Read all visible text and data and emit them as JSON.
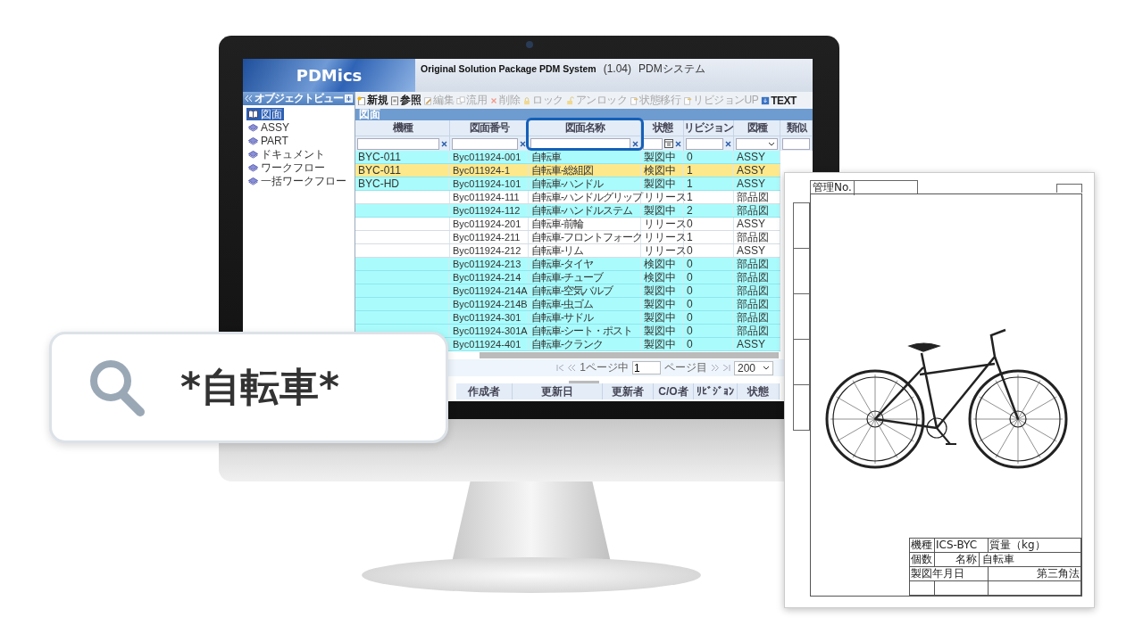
{
  "app": {
    "logo": "PDMics",
    "title": "Original Solution Package PDM System",
    "version": "(1.04)",
    "subtitle": "PDMシステム"
  },
  "sidebar": {
    "title": "オブジェクトビュー",
    "items": [
      {
        "label": "図面",
        "selected": true
      },
      {
        "label": "ASSY",
        "selected": false
      },
      {
        "label": "PART",
        "selected": false
      },
      {
        "label": "ドキュメント",
        "selected": false
      },
      {
        "label": "ワークフロー",
        "selected": false
      },
      {
        "label": "一括ワークフロー",
        "selected": false
      }
    ]
  },
  "toolbar": {
    "buttons": [
      {
        "label": "新規",
        "disabled": false
      },
      {
        "label": "参照",
        "disabled": false
      },
      {
        "label": "編集",
        "disabled": true
      },
      {
        "label": "流用",
        "disabled": true
      },
      {
        "label": "削除",
        "disabled": true
      },
      {
        "label": "ロック",
        "disabled": true
      },
      {
        "label": "アンロック",
        "disabled": true
      },
      {
        "label": "状態移行",
        "disabled": true
      },
      {
        "label": "リビジョンUP",
        "disabled": true
      },
      {
        "label": "TEXT",
        "disabled": false
      }
    ]
  },
  "panel_title": "図面",
  "table": {
    "columns": [
      "機種",
      "図面番号",
      "図面名称",
      "状態",
      "リビジョン",
      "図種",
      "類似"
    ],
    "rows": [
      {
        "model": "BYC-011",
        "number": "Byc011924-001",
        "name": "自転車",
        "status": "製図中",
        "revision": "0",
        "type": "ASSY",
        "selected": false,
        "highlighted": true
      },
      {
        "model": "BYC-011",
        "number": "Byc011924-1",
        "name": "自転車-総組図",
        "status": "検図中",
        "revision": "1",
        "type": "ASSY",
        "selected": true,
        "highlighted": true
      },
      {
        "model": "BYC-HD",
        "number": "Byc011924-101",
        "name": "自転車-ハンドル",
        "status": "製図中",
        "revision": "1",
        "type": "ASSY",
        "selected": false,
        "highlighted": true
      },
      {
        "number": "Byc011924-111",
        "name": "自転車-ハンドルグリップ",
        "status": "リリース",
        "revision": "1",
        "type": "部品図",
        "selected": false,
        "highlighted": false
      },
      {
        "number": "Byc011924-112",
        "name": "自転車-ハンドルステム",
        "status": "製図中",
        "revision": "2",
        "type": "部品図",
        "selected": false,
        "highlighted": true
      },
      {
        "number": "Byc011924-201",
        "name": "自転車-前輪",
        "status": "リリース",
        "revision": "0",
        "type": "ASSY",
        "selected": false,
        "highlighted": false
      },
      {
        "number": "Byc011924-211",
        "name": "自転車-フロントフォーク",
        "status": "リリース",
        "revision": "1",
        "type": "部品図",
        "selected": false,
        "highlighted": false
      },
      {
        "number": "Byc011924-212",
        "name": "自転車-リム",
        "status": "リリース",
        "revision": "0",
        "type": "ASSY",
        "selected": false,
        "highlighted": false
      },
      {
        "number": "Byc011924-213",
        "name": "自転車-タイヤ",
        "status": "検図中",
        "revision": "0",
        "type": "部品図",
        "selected": false,
        "highlighted": true
      },
      {
        "number": "Byc011924-214",
        "name": "自転車-チューブ",
        "status": "検図中",
        "revision": "0",
        "type": "部品図",
        "selected": false,
        "highlighted": true
      },
      {
        "number": "Byc011924-214A",
        "name": "自転車-空気バルブ",
        "status": "製図中",
        "revision": "0",
        "type": "部品図",
        "selected": false,
        "highlighted": true
      },
      {
        "number": "Byc011924-214B",
        "name": "自転車-虫ゴム",
        "status": "製図中",
        "revision": "0",
        "type": "部品図",
        "selected": false,
        "highlighted": true
      },
      {
        "number": "Byc011924-301",
        "name": "自転車-サドル",
        "status": "製図中",
        "revision": "0",
        "type": "部品図",
        "selected": false,
        "highlighted": true
      },
      {
        "number": "Byc011924-301A",
        "name": "自転車-シート・ポスト",
        "status": "製図中",
        "revision": "0",
        "type": "部品図",
        "selected": false,
        "highlighted": true
      },
      {
        "number": "Byc011924-401",
        "name": "自転車-クランク",
        "status": "製図中",
        "revision": "0",
        "type": "ASSY",
        "selected": false,
        "highlighted": true
      }
    ]
  },
  "pager": {
    "page_of": "1ページ中",
    "page": "1",
    "page_suffix": "ページ目",
    "page_size": "200"
  },
  "detail_table": {
    "columns": [
      "作成者",
      "更新日",
      "更新者",
      "C/O者",
      "ﾘﾋﾞｼﾞｮﾝ",
      "状態"
    ]
  },
  "search_callout": {
    "query": "*自転車*"
  },
  "drawing_sheet": {
    "management_label": "管理No.",
    "title_block": {
      "model_label": "機種",
      "model": "ICS-BYC",
      "mass_label": "質量（kg）",
      "quantity_label": "個数",
      "name_label": "名称",
      "name": "自転車",
      "date_label": "製図年月日",
      "projection": "第三角法"
    }
  }
}
